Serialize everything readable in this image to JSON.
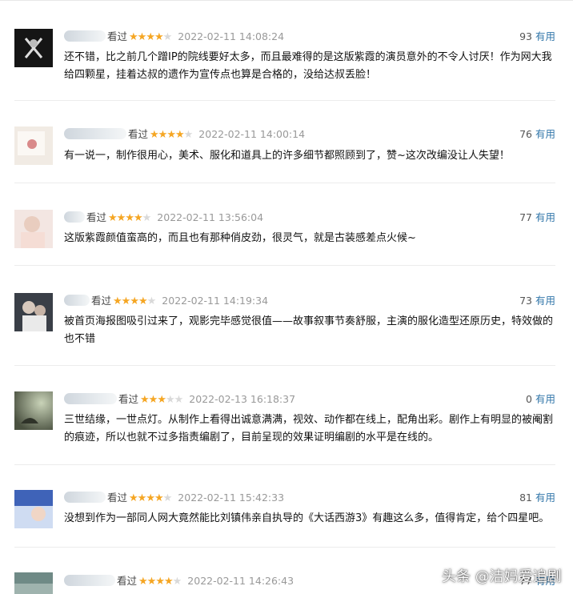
{
  "reviews": [
    {
      "status": "看过",
      "stars": 4,
      "time": "2022-02-11 14:08:24",
      "votes": "93",
      "vote_label": "有用",
      "text": "还不错，比之前几个蹭IP的院线要好太多，而且最难得的是这版紫霞的演员意外的不令人讨厌！作为网大我给四颗星，挂着达叔的遗作为宣传点也算是合格的，没给达叔丢脸！"
    },
    {
      "status": "看过",
      "stars": 4,
      "time": "2022-02-11 14:00:14",
      "votes": "76",
      "vote_label": "有用",
      "text": "有一说一，制作很用心，美术、服化和道具上的许多细节都照顾到了，赞~这次改编没让人失望！"
    },
    {
      "status": "看过",
      "stars": 4,
      "time": "2022-02-11 13:56:04",
      "votes": "77",
      "vote_label": "有用",
      "text": "这版紫霞颜值蛮高的，而且也有那种俏皮劲，很灵气，就是古装感差点火候~"
    },
    {
      "status": "看过",
      "stars": 4,
      "time": "2022-02-11 14:19:34",
      "votes": "73",
      "vote_label": "有用",
      "text": "被首页海报图吸引过来了，观影完毕感觉很值——故事叙事节奏舒服，主演的服化造型还原历史，特效做的也不错"
    },
    {
      "status": "看过",
      "stars": 3,
      "time": "2022-02-13 16:18:37",
      "votes": "0",
      "vote_label": "有用",
      "text": "三世结缘，一世点灯。从制作上看得出诚意满满，视效、动作都在线上，配角出彩。剧作上有明显的被阉割的痕迹，所以也就不过多指责编剧了，目前呈现的效果证明编剧的水平是在线的。"
    },
    {
      "status": "看过",
      "stars": 4,
      "time": "2022-02-11 15:42:33",
      "votes": "81",
      "vote_label": "有用",
      "text": "没想到作为一部同人网大竟然能比刘镇伟亲自执导的《大话西游3》有趣这么多，值得肯定，给个四星吧。"
    },
    {
      "status": "看过",
      "stars": 4,
      "time": "2022-02-11 14:26:43",
      "votes": "77",
      "vote_label": "有用",
      "text": ""
    }
  ],
  "watermark": "头条 @洁妈爱追剧",
  "colors": {
    "star": "#f5a623",
    "link": "#3377aa",
    "time": "#999999"
  }
}
